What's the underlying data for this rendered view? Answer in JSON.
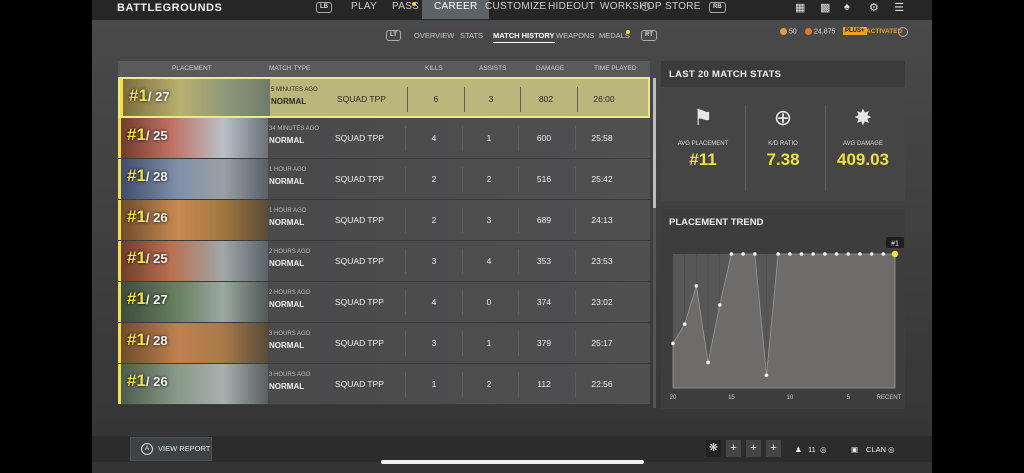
{
  "app": {
    "logo": "BATTLEGROUNDS"
  },
  "topnav": {
    "hint_left": "LB",
    "hint_right": "RB",
    "items": [
      "PLAY",
      "PASS",
      "CAREER",
      "CUSTOMIZE",
      "HIDEOUT",
      "WORKSHOP",
      "STORE"
    ],
    "active": "CAREER"
  },
  "subnav": {
    "hint_left": "LT",
    "hint_right": "RT",
    "items": [
      "OVERVIEW",
      "STATS",
      "MATCH HISTORY",
      "WEAPONS",
      "MEDALS"
    ],
    "active": "MATCH HISTORY"
  },
  "currency": {
    "coins": "50",
    "gcoin": "24,875",
    "plus_label": "PLUS+",
    "activated": "ACTIVATED"
  },
  "table": {
    "headers": [
      "PLACEMENT",
      "MATCH TYPE",
      "KILLS",
      "ASSISTS",
      "DAMAGE",
      "TIME PLAYED"
    ],
    "rows": [
      {
        "place": "#1",
        "total": "/ 27",
        "time_ago": "5 MINUTES AGO",
        "mode": "NORMAL",
        "type": "SQUAD TPP",
        "kills": "6",
        "assists": "3",
        "damage": "802",
        "time": "26:00"
      },
      {
        "place": "#1",
        "total": "/ 25",
        "time_ago": "34 MINUTES AGO",
        "mode": "NORMAL",
        "type": "SQUAD TPP",
        "kills": "4",
        "assists": "1",
        "damage": "600",
        "time": "25:58"
      },
      {
        "place": "#1",
        "total": "/ 28",
        "time_ago": "1 HOUR AGO",
        "mode": "NORMAL",
        "type": "SQUAD TPP",
        "kills": "2",
        "assists": "2",
        "damage": "516",
        "time": "25:42"
      },
      {
        "place": "#1",
        "total": "/ 26",
        "time_ago": "1 HOUR AGO",
        "mode": "NORMAL",
        "type": "SQUAD TPP",
        "kills": "2",
        "assists": "3",
        "damage": "689",
        "time": "24:13"
      },
      {
        "place": "#1",
        "total": "/ 25",
        "time_ago": "2 HOURS AGO",
        "mode": "NORMAL",
        "type": "SQUAD TPP",
        "kills": "3",
        "assists": "4",
        "damage": "353",
        "time": "23:53"
      },
      {
        "place": "#1",
        "total": "/ 27",
        "time_ago": "2 HOURS AGO",
        "mode": "NORMAL",
        "type": "SQUAD TPP",
        "kills": "4",
        "assists": "0",
        "damage": "374",
        "time": "23:02"
      },
      {
        "place": "#1",
        "total": "/ 28",
        "time_ago": "3 HOURS AGO",
        "mode": "NORMAL",
        "type": "SQUAD TPP",
        "kills": "3",
        "assists": "1",
        "damage": "379",
        "time": "25:17"
      },
      {
        "place": "#1",
        "total": "/ 26",
        "time_ago": "3 HOURS AGO",
        "mode": "NORMAL",
        "type": "SQUAD TPP",
        "kills": "1",
        "assists": "2",
        "damage": "112",
        "time": "22:56"
      }
    ]
  },
  "stats": {
    "title": "LAST 20 MATCH STATS",
    "items": [
      {
        "label": "AVG PLACEMENT",
        "value": "#11"
      },
      {
        "label": "K/D RATIO",
        "value": "7.38"
      },
      {
        "label": "AVG DAMAGE",
        "value": "409.03"
      }
    ]
  },
  "trend": {
    "title": "PLACEMENT TREND",
    "latest_badge": "#1",
    "x_ticks": [
      "20",
      "15",
      "10",
      "5",
      "RECENT"
    ]
  },
  "chart_data": {
    "type": "area",
    "title": "PLACEMENT TREND",
    "x": [
      20,
      19,
      18,
      17,
      16,
      15,
      14,
      13,
      12,
      11,
      10,
      9,
      8,
      7,
      6,
      5,
      4,
      3,
      2,
      1
    ],
    "series": [
      {
        "values": [
          15,
          12,
          6,
          18,
          9,
          1,
          1,
          1,
          20,
          1,
          1,
          1,
          1,
          1,
          1,
          1,
          1,
          1,
          1,
          1
        ]
      }
    ],
    "x_ticks": [
      "20",
      "15",
      "10",
      "5",
      "RECENT"
    ],
    "ylim": [
      1,
      22
    ],
    "y_inverted": true,
    "colors": {
      "fill": "#6e6b6b",
      "line": "#9a9797",
      "point": "#f2f2f2",
      "latest": "#f2e046"
    }
  },
  "bottom": {
    "view_report": "VIEW REPORT",
    "a_key": "A",
    "friends": "11",
    "clan": "CLAN"
  },
  "colors": {
    "accent": "#f2e046",
    "highlight": "#bab67c"
  }
}
